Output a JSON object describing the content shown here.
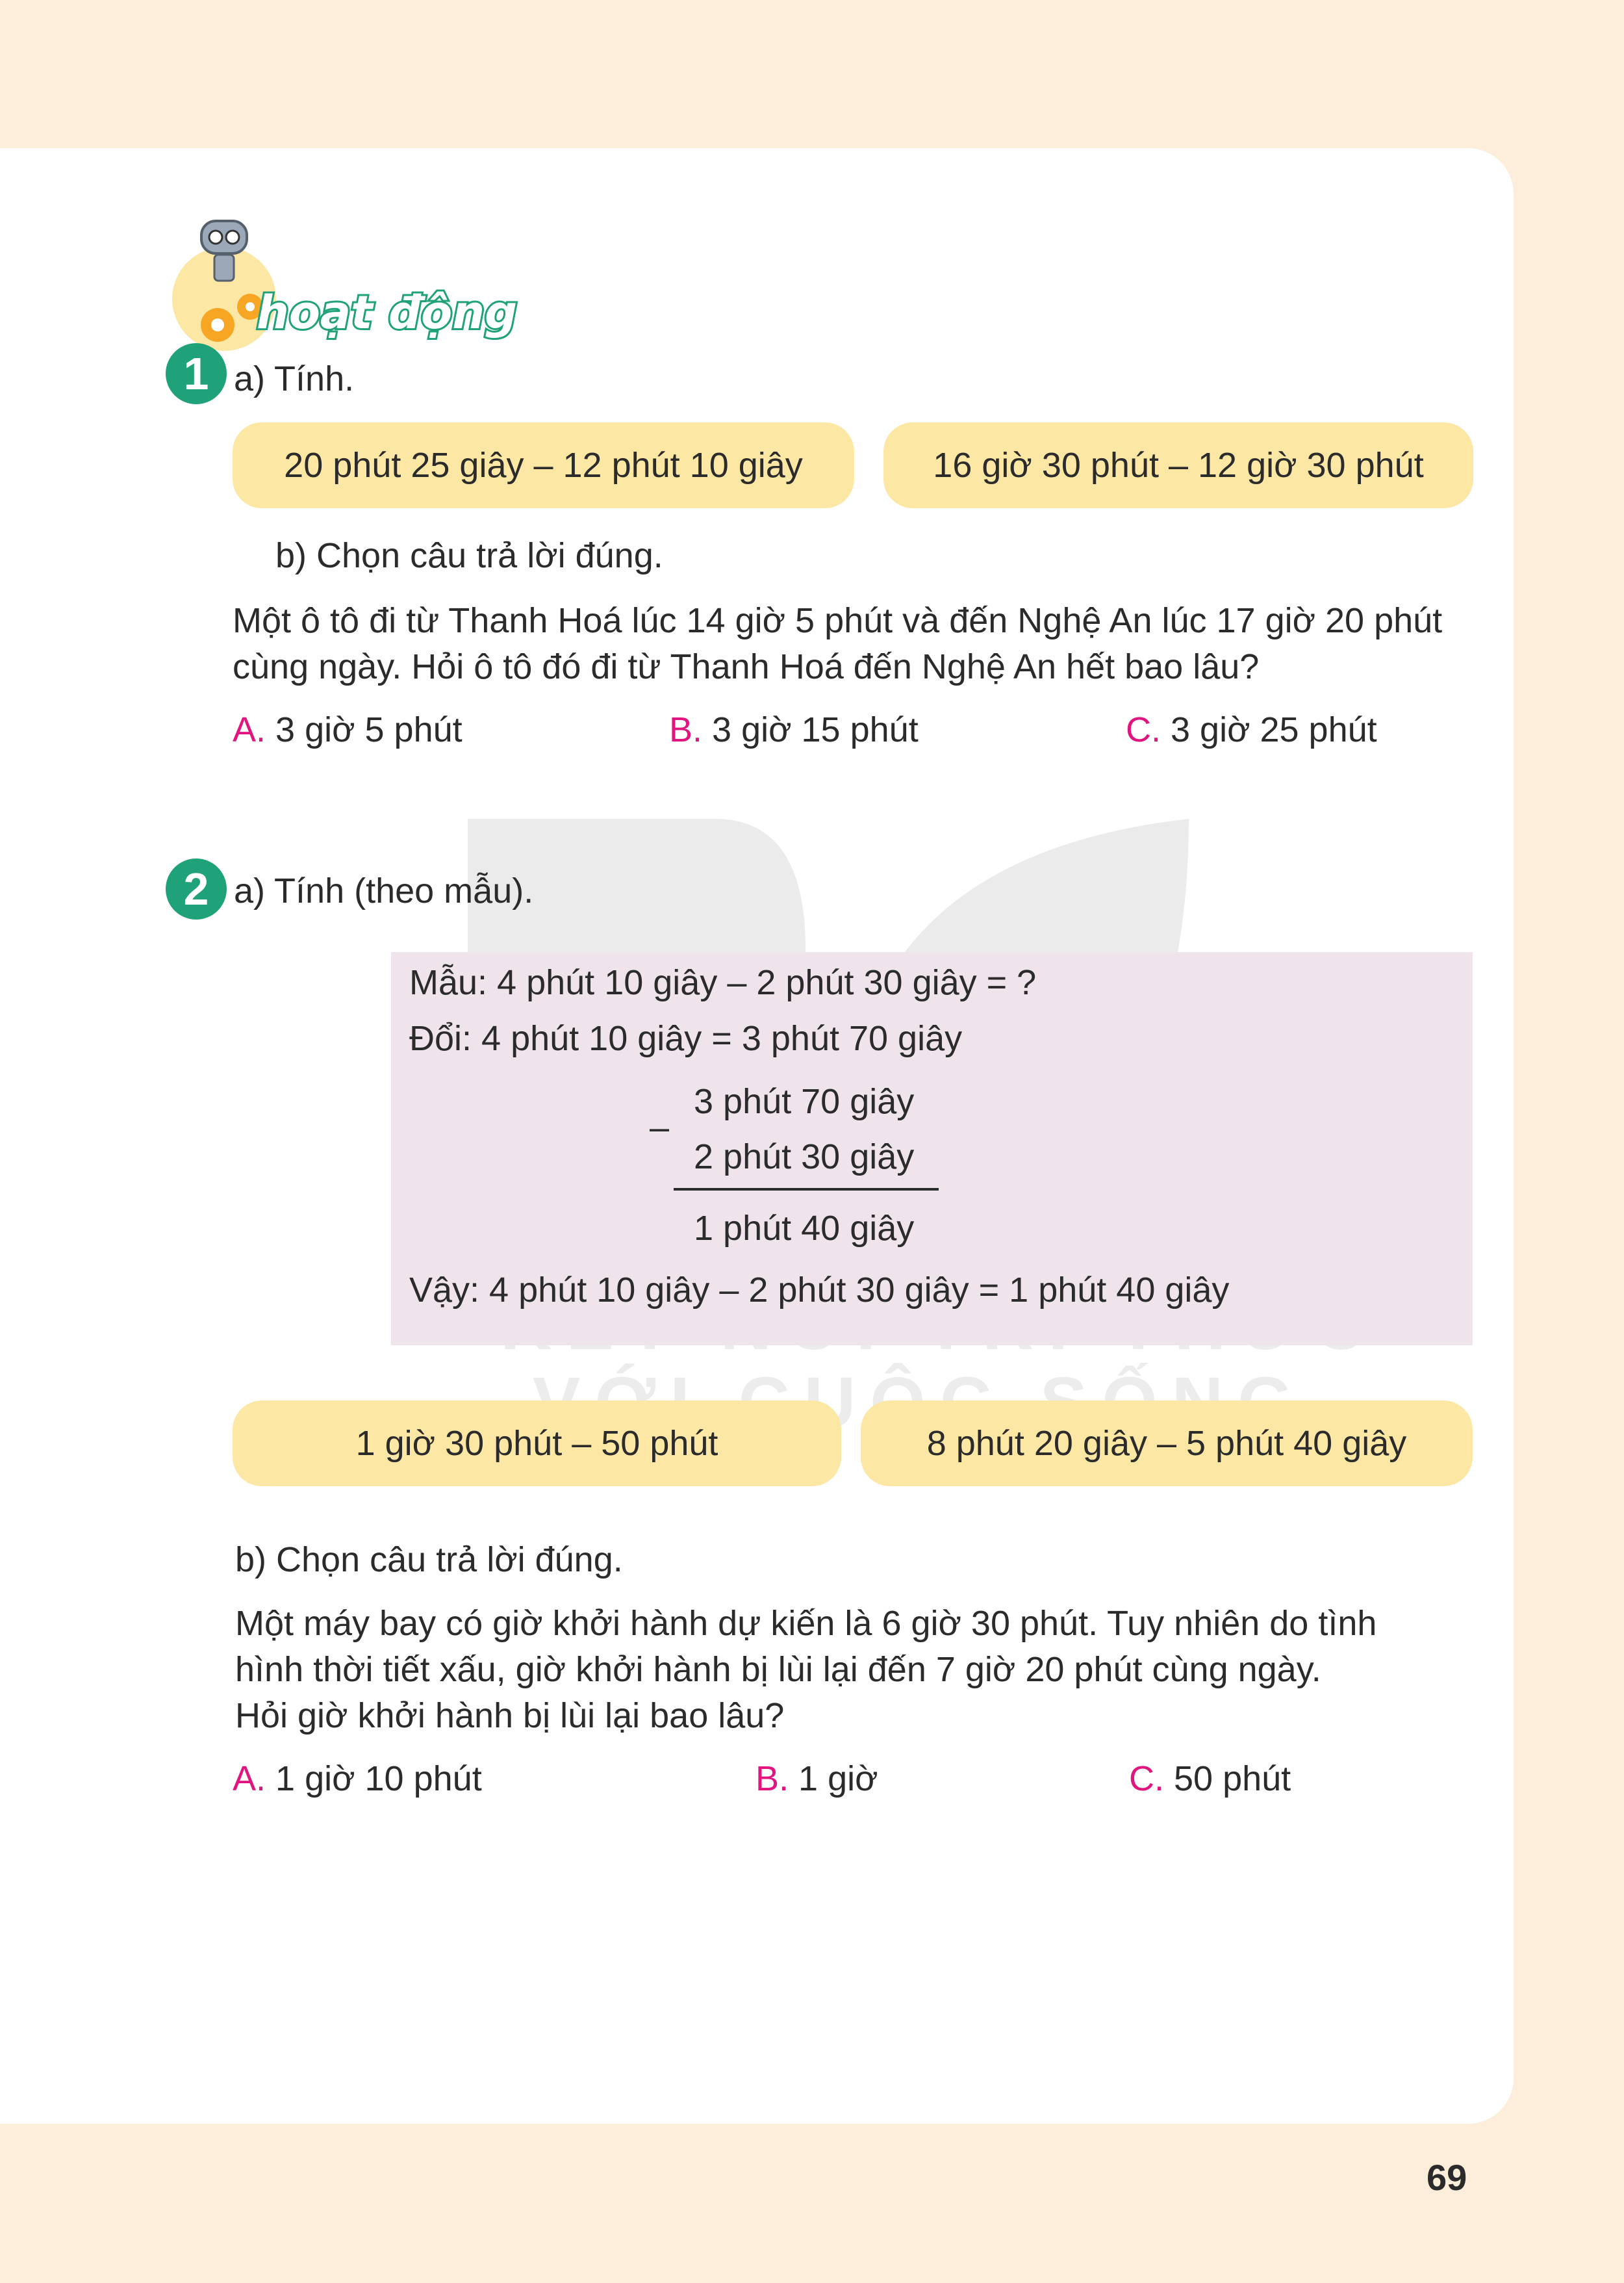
{
  "header": {
    "section_label": "hoạt động"
  },
  "activity1": {
    "number": "1",
    "part_a_label": "a) Tính.",
    "expressions": [
      "20 phút 25 giây – 12 phút 10 giây",
      "16 giờ 30 phút – 12 giờ 30 phút"
    ],
    "part_b_label": "b) Chọn câu trả lời đúng.",
    "problem_lines": [
      "Một ô tô đi từ Thanh Hoá lúc 14 giờ 5 phút và đến Nghệ An lúc 17 giờ 20 phút",
      "cùng ngày. Hỏi ô tô đó đi từ Thanh Hoá đến Nghệ An hết bao lâu?"
    ],
    "options": [
      {
        "letter": "A.",
        "text": "3 giờ 5 phút"
      },
      {
        "letter": "B.",
        "text": "3 giờ 15 phút"
      },
      {
        "letter": "C.",
        "text": "3 giờ 25 phút"
      }
    ]
  },
  "activity2": {
    "number": "2",
    "part_a_label": "a) Tính (theo mẫu).",
    "sample": {
      "line1": "Mẫu: 4 phút 10 giây – 2 phút 30 giây = ?",
      "line2": "Đổi: 4 phút 10 giây = 3 phút 70 giây",
      "minus_sign": "–",
      "top": "3 phút 70 giây",
      "bottom": "2 phút 30 giây",
      "result": "1 phút 40 giây",
      "conclusion": "Vậy: 4 phút 10 giây – 2 phút 30 giây = 1 phút 40 giây"
    },
    "expressions": [
      "1 giờ 30 phút – 50 phút",
      "8 phút 20 giây – 5 phút 40 giây"
    ],
    "part_b_label": "b) Chọn câu trả lời đúng.",
    "problem_lines": [
      "Một máy bay có giờ khởi hành dự kiến là 6 giờ 30 phút. Tuy nhiên do tình",
      "hình thời tiết xấu, giờ khởi hành bị lùi lại đến 7 giờ 20 phút cùng ngày.",
      "Hỏi giờ khởi hành bị lùi lại bao lâu?"
    ],
    "options": [
      {
        "letter": "A.",
        "text": "1 giờ 10 phút"
      },
      {
        "letter": "B.",
        "text": "1 giờ"
      },
      {
        "letter": "C.",
        "text": "50 phút"
      }
    ]
  },
  "watermark": {
    "line1": "KẾT NỐI TRI THỨC",
    "line2": "VỚI CUỘC SỐNG"
  },
  "footer": {
    "page_number": "69"
  },
  "colors": {
    "accent_green": "#1fa27a",
    "option_letter": "#e0157f",
    "pill_yellow": "#fde7a4",
    "sample_bg": "#efe3ec",
    "page_bg": "#fdeedc"
  }
}
